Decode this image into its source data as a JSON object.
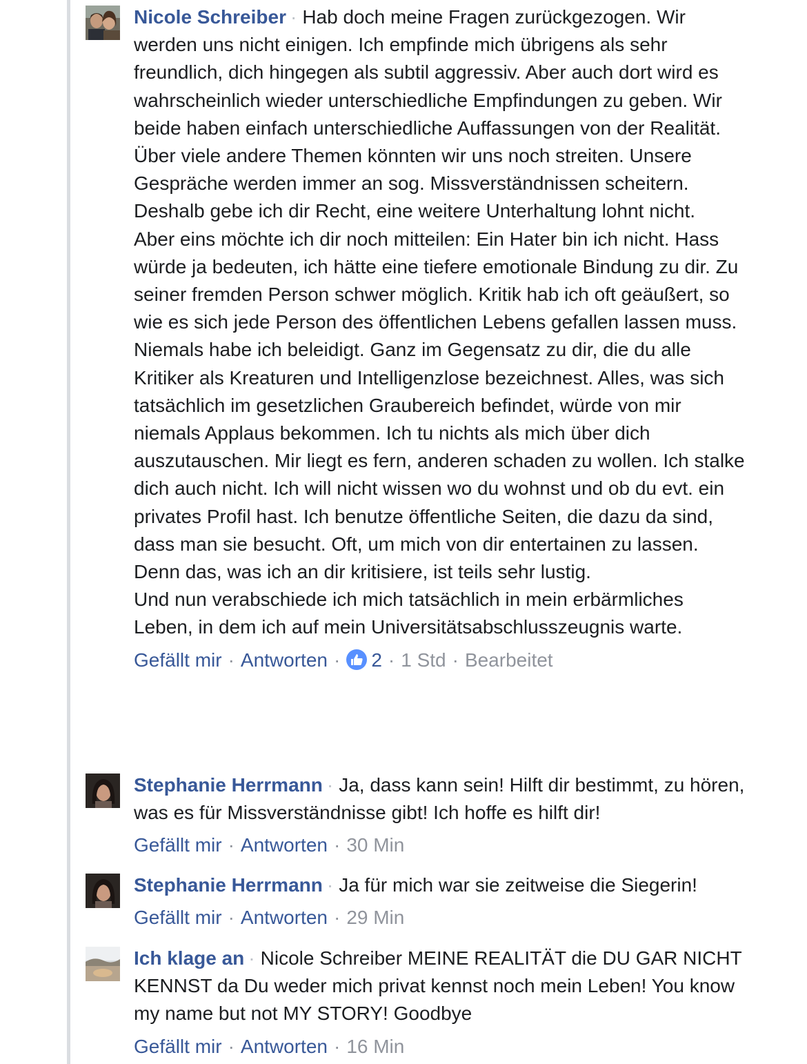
{
  "comments": [
    {
      "author": "Nicole Schreiber",
      "paragraphs": [
        "Hab doch meine Fragen zurückgezogen. Wir werden uns nicht einigen. Ich empfinde mich übrigens als sehr freundlich, dich hingegen als subtil aggressiv. Aber auch dort wird es wahrscheinlich wieder unterschiedliche Empfindungen zu geben. Wir beide haben einfach unterschiedliche Auffassungen von der Realität. Über viele andere Themen könnten wir uns noch streiten. Unsere Gespräche werden immer an sog. Missverständnissen scheitern. Deshalb gebe ich dir Recht, eine weitere Unterhaltung lohnt nicht.",
        "Aber eins möchte ich dir noch mitteilen: Ein Hater bin ich nicht. Hass würde ja bedeuten, ich hätte eine tiefere emotionale Bindung zu dir. Zu seiner fremden Person schwer möglich. Kritik hab ich oft geäußert, so wie es sich jede Person des öffentlichen Lebens gefallen lassen muss. Niemals habe ich beleidigt. Ganz im Gegensatz zu dir, die du alle Kritiker als Kreaturen und Intelligenzlose bezeichnest. Alles, was sich tatsächlich im gesetzlichen Graubereich befindet, würde von mir niemals Applaus bekommen. Ich tu nichts als mich über dich auszutauschen. Mir liegt es fern, anderen schaden zu wollen. Ich stalke dich auch nicht. Ich will nicht wissen wo du wohnst und ob du evt. ein privates Profil hast. Ich benutze öffentliche Seiten, die dazu da sind, dass man sie besucht. Oft, um mich von dir entertainen zu lassen. Denn das, was ich an dir kritisiere, ist teils sehr lustig.",
        "Und nun verabschiede ich mich tatsächlich in mein erbärmliches Leben, in dem ich auf mein Universitätsabschlusszeugnis warte."
      ],
      "like_label": "Gefällt mir",
      "reply_label": "Antworten",
      "like_count": "2",
      "time": "1 Std",
      "edited": "Bearbeitet"
    },
    {
      "author": "Stephanie Herrmann",
      "paragraphs": [
        "Ja, dass kann sein! Hilft dir bestimmt, zu hören, was es für Missverständnisse gibt! Ich hoffe es hilft dir!"
      ],
      "like_label": "Gefällt mir",
      "reply_label": "Antworten",
      "time": "30 Min"
    },
    {
      "author": "Stephanie Herrmann",
      "paragraphs": [
        "Ja für mich war sie zeitweise die Siegerin!"
      ],
      "like_label": "Gefällt mir",
      "reply_label": "Antworten",
      "time": "29 Min"
    },
    {
      "author": "Ich klage an",
      "paragraphs": [
        "Nicole Schreiber MEINE REALITÄT die DU GAR NICHT KENNST da Du weder mich privat kennst noch mein Leben! You know my name but not MY STORY! Goodbye"
      ],
      "like_label": "Gefällt mir",
      "reply_label": "Antworten",
      "time": "16 Min"
    }
  ],
  "separators": {
    "dot": "·"
  },
  "colors": {
    "author_link": "#385898",
    "body_text": "#1c1e21",
    "meta_gray": "#90949c",
    "like_blue": "#5890ff",
    "rail": "#dadde1"
  },
  "icons": {
    "like_reaction": "thumbs-up-icon"
  }
}
